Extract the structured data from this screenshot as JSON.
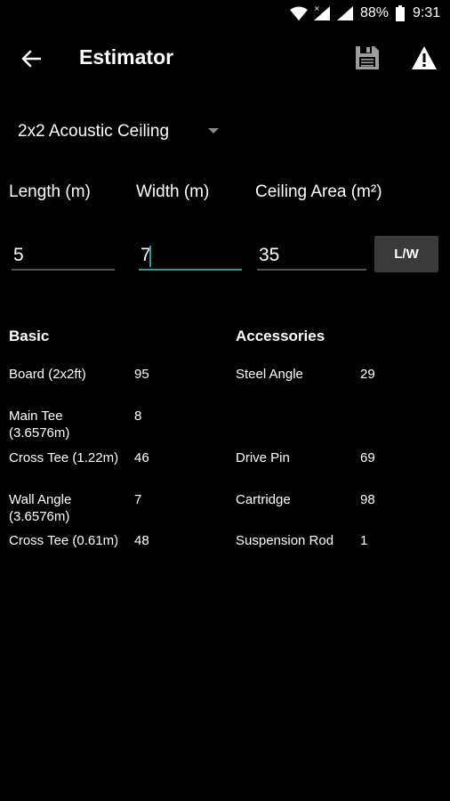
{
  "status_bar": {
    "battery": "88%",
    "time": "9:31"
  },
  "app_bar": {
    "title": "Estimator",
    "icons": [
      "back-arrow-icon",
      "save-icon",
      "warning-icon"
    ]
  },
  "dropdown": {
    "selected": "2x2 Acoustic Ceiling"
  },
  "fields": {
    "length": {
      "label": "Length (m)",
      "value": "5"
    },
    "width": {
      "label": "Width (m)",
      "value": "7"
    },
    "area": {
      "label": "Ceiling Area (m²)",
      "value": "35"
    }
  },
  "lw_button": "L/W",
  "basic": {
    "heading": "Basic",
    "rows": [
      {
        "label": "Board (2x2ft)",
        "value": "95"
      },
      {
        "label": "Main Tee\n(3.6576m)",
        "value": "8"
      },
      {
        "label": "Cross Tee (1.22m)",
        "value": "46"
      },
      {
        "label": "Wall Angle\n(3.6576m)",
        "value": "7"
      },
      {
        "label": "Cross Tee (0.61m)",
        "value": "48"
      }
    ]
  },
  "accessories": {
    "heading": "Accessories",
    "rows": [
      {
        "label": "Steel Angle",
        "value": "29"
      },
      {
        "label": "Drive Pin",
        "value": "69"
      },
      {
        "label": "Cartridge",
        "value": "98"
      },
      {
        "label": "Suspension Rod",
        "value": "1"
      }
    ]
  }
}
